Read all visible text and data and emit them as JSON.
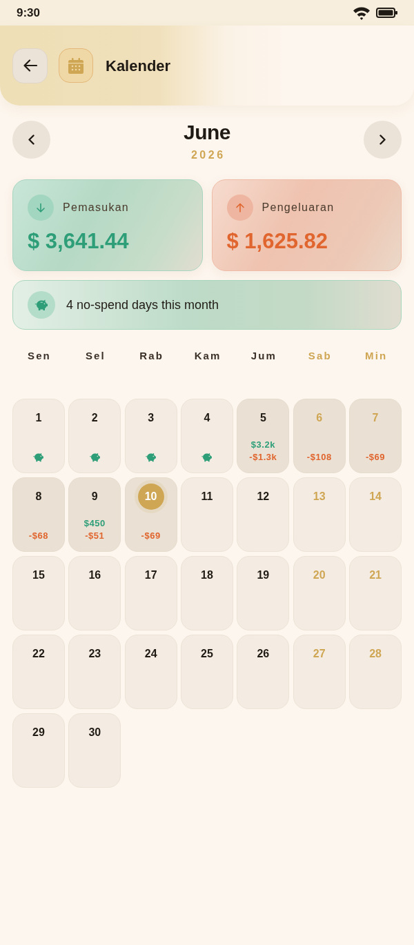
{
  "status_bar": {
    "time": "9:30"
  },
  "header": {
    "title": "Kalender"
  },
  "month_nav": {
    "month": "June",
    "year": "2026"
  },
  "summary_cards": [
    {
      "kind": "income",
      "label": "Pemasukan",
      "amount": "$ 3,641.44"
    },
    {
      "kind": "expense",
      "label": "Pengeluaran",
      "amount": "$ 1,625.82"
    }
  ],
  "no_spend_banner": {
    "text": "4 no-spend days this month"
  },
  "weekdays": [
    {
      "label": "Sen",
      "weekend": false
    },
    {
      "label": "Sel",
      "weekend": false
    },
    {
      "label": "Rab",
      "weekend": false
    },
    {
      "label": "Kam",
      "weekend": false
    },
    {
      "label": "Jum",
      "weekend": false
    },
    {
      "label": "Sab",
      "weekend": true
    },
    {
      "label": "Min",
      "weekend": true
    }
  ],
  "days": [
    {
      "day": "1",
      "weekend": false,
      "today": false,
      "has_transactions": false,
      "no_spend": true
    },
    {
      "day": "2",
      "weekend": false,
      "today": false,
      "has_transactions": false,
      "no_spend": true
    },
    {
      "day": "3",
      "weekend": false,
      "today": false,
      "has_transactions": false,
      "no_spend": true
    },
    {
      "day": "4",
      "weekend": false,
      "today": false,
      "has_transactions": false,
      "no_spend": true
    },
    {
      "day": "5",
      "weekend": false,
      "today": false,
      "has_transactions": true,
      "no_spend": false,
      "income": "$3.2k",
      "expense": "-$1.3k"
    },
    {
      "day": "6",
      "weekend": true,
      "today": false,
      "has_transactions": true,
      "no_spend": false,
      "expense": "-$108"
    },
    {
      "day": "7",
      "weekend": true,
      "today": false,
      "has_transactions": true,
      "no_spend": false,
      "expense": "-$69"
    },
    {
      "day": "8",
      "weekend": false,
      "today": false,
      "has_transactions": true,
      "no_spend": false,
      "expense": "-$68"
    },
    {
      "day": "9",
      "weekend": false,
      "today": false,
      "has_transactions": true,
      "no_spend": false,
      "income": "$450",
      "expense": "-$51"
    },
    {
      "day": "10",
      "weekend": false,
      "today": true,
      "has_transactions": true,
      "no_spend": false,
      "expense": "-$69"
    },
    {
      "day": "11",
      "weekend": false,
      "today": false,
      "has_transactions": false,
      "no_spend": false
    },
    {
      "day": "12",
      "weekend": false,
      "today": false,
      "has_transactions": false,
      "no_spend": false
    },
    {
      "day": "13",
      "weekend": true,
      "today": false,
      "has_transactions": false,
      "no_spend": false
    },
    {
      "day": "14",
      "weekend": true,
      "today": false,
      "has_transactions": false,
      "no_spend": false
    },
    {
      "day": "15",
      "weekend": false,
      "today": false,
      "has_transactions": false,
      "no_spend": false
    },
    {
      "day": "16",
      "weekend": false,
      "today": false,
      "has_transactions": false,
      "no_spend": false
    },
    {
      "day": "17",
      "weekend": false,
      "today": false,
      "has_transactions": false,
      "no_spend": false
    },
    {
      "day": "18",
      "weekend": false,
      "today": false,
      "has_transactions": false,
      "no_spend": false
    },
    {
      "day": "19",
      "weekend": false,
      "today": false,
      "has_transactions": false,
      "no_spend": false
    },
    {
      "day": "20",
      "weekend": true,
      "today": false,
      "has_transactions": false,
      "no_spend": false
    },
    {
      "day": "21",
      "weekend": true,
      "today": false,
      "has_transactions": false,
      "no_spend": false
    },
    {
      "day": "22",
      "weekend": false,
      "today": false,
      "has_transactions": false,
      "no_spend": false
    },
    {
      "day": "23",
      "weekend": false,
      "today": false,
      "has_transactions": false,
      "no_spend": false
    },
    {
      "day": "24",
      "weekend": false,
      "today": false,
      "has_transactions": false,
      "no_spend": false
    },
    {
      "day": "25",
      "weekend": false,
      "today": false,
      "has_transactions": false,
      "no_spend": false
    },
    {
      "day": "26",
      "weekend": false,
      "today": false,
      "has_transactions": false,
      "no_spend": false
    },
    {
      "day": "27",
      "weekend": true,
      "today": false,
      "has_transactions": false,
      "no_spend": false
    },
    {
      "day": "28",
      "weekend": true,
      "today": false,
      "has_transactions": false,
      "no_spend": false
    },
    {
      "day": "29",
      "weekend": false,
      "today": false,
      "has_transactions": false,
      "no_spend": false
    },
    {
      "day": "30",
      "weekend": false,
      "today": false,
      "has_transactions": false,
      "no_spend": false
    }
  ]
}
